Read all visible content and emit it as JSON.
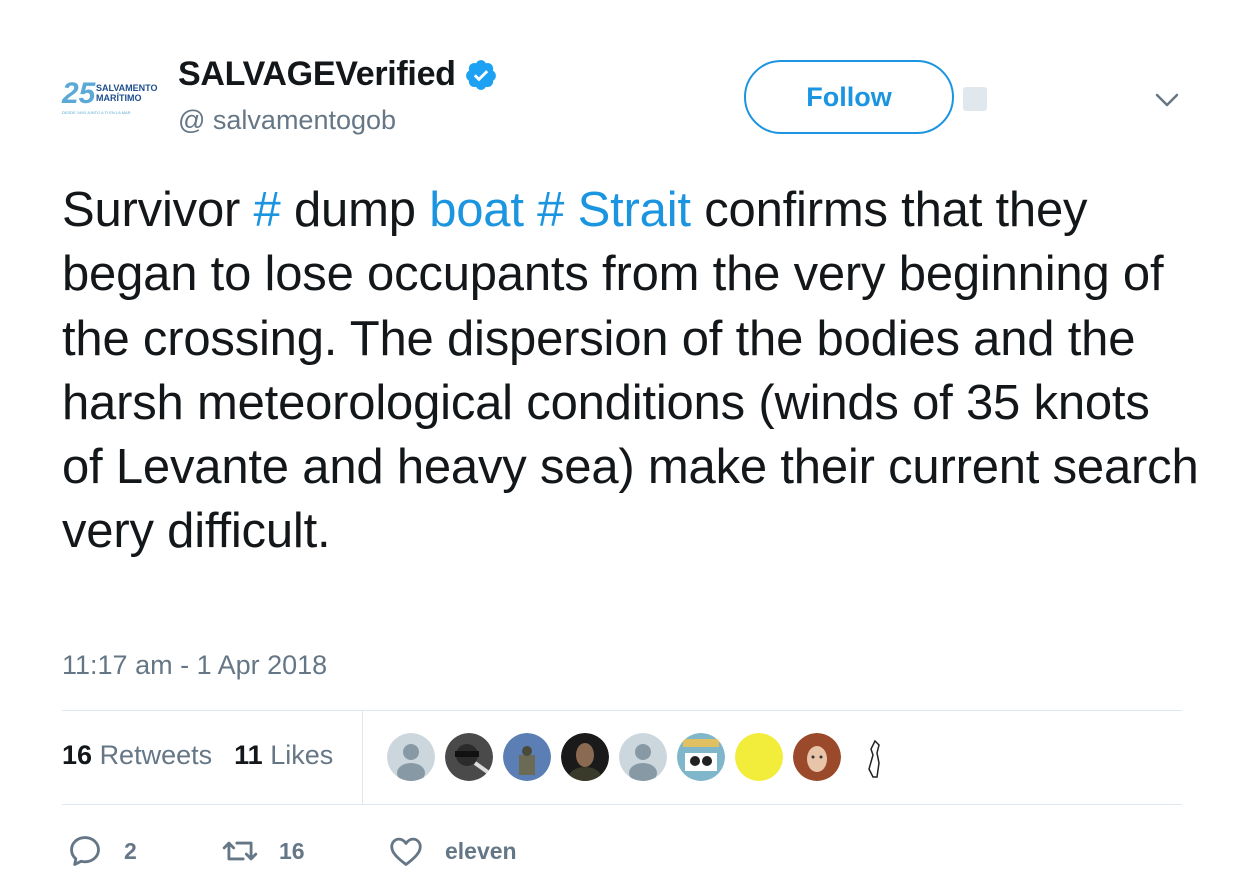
{
  "tweet": {
    "author": {
      "display_name": "SALVAGEVerified",
      "handle": "@ salvamentogob",
      "logo_number": "25",
      "logo_line1": "SALVAMENTO",
      "logo_line2": "MARÍTIMO",
      "logo_tagline": "DESDE 1993 JUNTO A TI EN LA MAR"
    },
    "follow_label": "Follow",
    "text_parts": {
      "p1": "Survivor ",
      "p2": "# ",
      "p3": "dump ",
      "p4": "boat # Strait",
      "p5": " confirms that they began to lose occupants from the very beginning of the crossing. The dispersion of the bodies and the harsh meteorological conditions (winds of 35 knots of Levante and heavy sea) make their current search very difficult."
    },
    "timestamp": "11:17 am - 1 Apr 2018",
    "stats": {
      "retweets_count": "16",
      "retweets_label": "Retweets",
      "likes_count": "11",
      "likes_label": "Likes"
    },
    "likers_count": 9,
    "actions": {
      "replies": "2",
      "retweets": "16",
      "likes": "eleven"
    }
  },
  "colors": {
    "link": "#1b95e0",
    "text": "#14171a",
    "muted": "#657786",
    "border": "#e1e8ed"
  }
}
